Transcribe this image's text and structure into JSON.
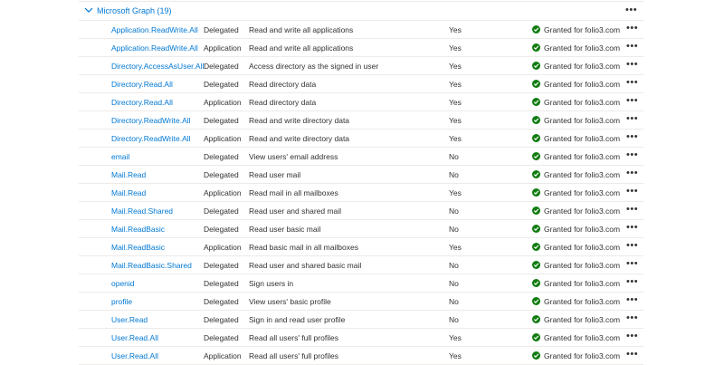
{
  "group": {
    "label": "Microsoft Graph (19)",
    "more_label": "•••"
  },
  "colors": {
    "link": "#0078d4",
    "granted": "#107c10",
    "text": "#323130",
    "separator": "#edebe9"
  },
  "icons": {
    "group_toggle": "chevron-down-icon",
    "granted": "checkmark-circle-icon",
    "row_more": "more-icon"
  },
  "rows": [
    {
      "name": "Application.ReadWrite.All",
      "type": "Delegated",
      "description": "Read and write all applications",
      "admin_consent": "Yes",
      "status": "Granted for folio3.com",
      "more": "•••"
    },
    {
      "name": "Application.ReadWrite.All",
      "type": "Application",
      "description": "Read and write all applications",
      "admin_consent": "Yes",
      "status": "Granted for folio3.com",
      "more": "•••"
    },
    {
      "name": "Directory.AccessAsUser.All",
      "type": "Delegated",
      "description": "Access directory as the signed in user",
      "admin_consent": "Yes",
      "status": "Granted for folio3.com",
      "more": "•••"
    },
    {
      "name": "Directory.Read.All",
      "type": "Delegated",
      "description": "Read directory data",
      "admin_consent": "Yes",
      "status": "Granted for folio3.com",
      "more": "•••"
    },
    {
      "name": "Directory.Read.All",
      "type": "Application",
      "description": "Read directory data",
      "admin_consent": "Yes",
      "status": "Granted for folio3.com",
      "more": "•••"
    },
    {
      "name": "Directory.ReadWrite.All",
      "type": "Delegated",
      "description": "Read and write directory data",
      "admin_consent": "Yes",
      "status": "Granted for folio3.com",
      "more": "•••"
    },
    {
      "name": "Directory.ReadWrite.All",
      "type": "Application",
      "description": "Read and write directory data",
      "admin_consent": "Yes",
      "status": "Granted for folio3.com",
      "more": "•••"
    },
    {
      "name": "email",
      "type": "Delegated",
      "description": "View users' email address",
      "admin_consent": "No",
      "status": "Granted for folio3.com",
      "more": "•••"
    },
    {
      "name": "Mail.Read",
      "type": "Delegated",
      "description": "Read user mail",
      "admin_consent": "No",
      "status": "Granted for folio3.com",
      "more": "•••"
    },
    {
      "name": "Mail.Read",
      "type": "Application",
      "description": "Read mail in all mailboxes",
      "admin_consent": "Yes",
      "status": "Granted for folio3.com",
      "more": "•••"
    },
    {
      "name": "Mail.Read.Shared",
      "type": "Delegated",
      "description": "Read user and shared mail",
      "admin_consent": "No",
      "status": "Granted for folio3.com",
      "more": "•••"
    },
    {
      "name": "Mail.ReadBasic",
      "type": "Delegated",
      "description": "Read user basic mail",
      "admin_consent": "No",
      "status": "Granted for folio3.com",
      "more": "•••"
    },
    {
      "name": "Mail.ReadBasic",
      "type": "Application",
      "description": "Read basic mail in all mailboxes",
      "admin_consent": "Yes",
      "status": "Granted for folio3.com",
      "more": "•••"
    },
    {
      "name": "Mail.ReadBasic.Shared",
      "type": "Delegated",
      "description": "Read user and shared basic mail",
      "admin_consent": "No",
      "status": "Granted for folio3.com",
      "more": "•••"
    },
    {
      "name": "openid",
      "type": "Delegated",
      "description": "Sign users in",
      "admin_consent": "No",
      "status": "Granted for folio3.com",
      "more": "•••"
    },
    {
      "name": "profile",
      "type": "Delegated",
      "description": "View users' basic profile",
      "admin_consent": "No",
      "status": "Granted for folio3.com",
      "more": "•••"
    },
    {
      "name": "User.Read",
      "type": "Delegated",
      "description": "Sign in and read user profile",
      "admin_consent": "No",
      "status": "Granted for folio3.com",
      "more": "•••"
    },
    {
      "name": "User.Read.All",
      "type": "Delegated",
      "description": "Read all users' full profiles",
      "admin_consent": "Yes",
      "status": "Granted for folio3.com",
      "more": "•••"
    },
    {
      "name": "User.Read.All",
      "type": "Application",
      "description": "Read all users' full profiles",
      "admin_consent": "Yes",
      "status": "Granted for folio3.com",
      "more": "•••"
    }
  ]
}
